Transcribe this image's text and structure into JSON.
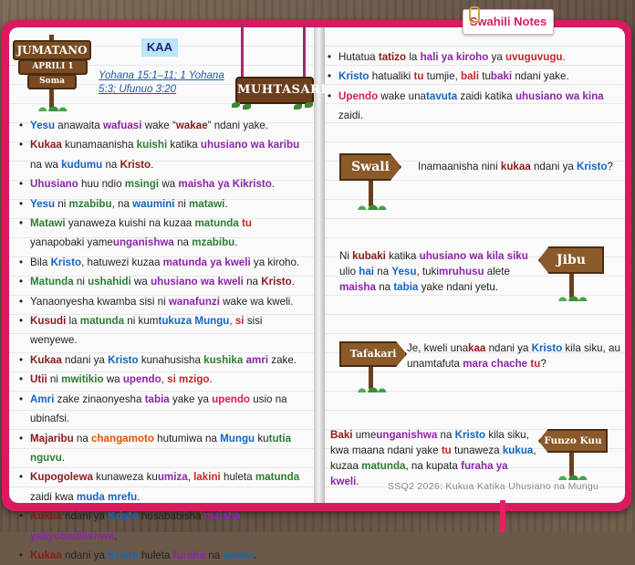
{
  "tag": {
    "label": "Swahili Notes"
  },
  "header": {
    "day": "JUMATANO",
    "date": "APRILI 1",
    "soma": "Soma",
    "badge": "KAA",
    "references": "Yohana 15:1–11; 1 Yohana 5:3; Ufunuo 3:20",
    "banner": "MUHTASARI"
  },
  "left_bullets": [
    [
      [
        "Yesu",
        "blue"
      ],
      [
        " anawaita "
      ],
      [
        "wafuasi",
        "purple"
      ],
      [
        " wake “"
      ],
      [
        "wakae",
        "maroon"
      ],
      [
        "” ndani yake."
      ]
    ],
    [
      [
        "Kukaa",
        "maroon"
      ],
      [
        " kunamaanisha "
      ],
      [
        "kuishi",
        "green"
      ],
      [
        " katika "
      ],
      [
        "uhusiano wa karibu",
        "purple"
      ],
      [
        " na wa "
      ],
      [
        "kudumu",
        "blue"
      ],
      [
        " na "
      ],
      [
        "Kristo",
        "maroon"
      ],
      [
        "."
      ]
    ],
    [
      [
        "Uhusiano",
        "purple"
      ],
      [
        " huu ndio "
      ],
      [
        "msingi",
        "green"
      ],
      [
        " wa "
      ],
      [
        "maisha ya Kikristo",
        "purple"
      ],
      [
        "."
      ]
    ],
    [
      [
        "Yesu",
        "blue"
      ],
      [
        " ni "
      ],
      [
        "mzabibu",
        "green"
      ],
      [
        ", na "
      ],
      [
        "waumini",
        "blue"
      ],
      [
        " ni "
      ],
      [
        "matawi",
        "green"
      ],
      [
        "."
      ]
    ],
    [
      [
        "Matawi",
        "green"
      ],
      [
        " yanaweza kuishi na kuzaa "
      ],
      [
        "matunda",
        "green"
      ],
      [
        " "
      ],
      [
        "tu",
        "red"
      ],
      [
        " yanapobaki yame"
      ],
      [
        "unganishwa",
        "purple"
      ],
      [
        " na "
      ],
      [
        "mzabibu",
        "green"
      ],
      [
        "."
      ]
    ],
    [
      [
        "Bila "
      ],
      [
        "Kristo",
        "blue"
      ],
      [
        ", hatuwezi kuzaa "
      ],
      [
        "matunda ya kweli",
        "purple"
      ],
      [
        " ya kiroho."
      ]
    ],
    [
      [
        "Matunda",
        "green"
      ],
      [
        " ni "
      ],
      [
        "ushahidi",
        "green"
      ],
      [
        " wa "
      ],
      [
        "uhusiano wa kweli",
        "purple"
      ],
      [
        " na "
      ],
      [
        "Kristo",
        "maroon"
      ],
      [
        "."
      ]
    ],
    [
      [
        "Yanaonyesha kwamba sisi ni "
      ],
      [
        "wanafunzi",
        "purple"
      ],
      [
        " wake wa kweli."
      ]
    ],
    [
      [
        "Kusudi",
        "maroon"
      ],
      [
        " la "
      ],
      [
        "matunda",
        "green"
      ],
      [
        " ni kum"
      ],
      [
        "tukuza",
        "blue"
      ],
      [
        " "
      ],
      [
        "Mungu",
        "blue"
      ],
      [
        ", "
      ],
      [
        "si",
        "red"
      ],
      [
        " sisi wenyewe."
      ]
    ],
    [
      [
        "Kukaa",
        "maroon"
      ],
      [
        " ndani ya "
      ],
      [
        "Kristo",
        "blue"
      ],
      [
        " kunahusisha "
      ],
      [
        "kushika",
        "green"
      ],
      [
        " "
      ],
      [
        "amri",
        "purple"
      ],
      [
        " zake."
      ]
    ],
    [
      [
        "Utii",
        "maroon"
      ],
      [
        " ni "
      ],
      [
        "mwitikio",
        "green"
      ],
      [
        " wa "
      ],
      [
        "upendo",
        "purple"
      ],
      [
        ", "
      ],
      [
        "si mzigo",
        "red"
      ],
      [
        "."
      ]
    ],
    [
      [
        "Amri",
        "blue"
      ],
      [
        " zake zinaonyesha "
      ],
      [
        "tabia",
        "purple"
      ],
      [
        " yake ya "
      ],
      [
        "upendo",
        "magenta"
      ],
      [
        " usio na ubinafsi."
      ]
    ],
    [
      [
        "Majaribu",
        "maroon"
      ],
      [
        " na "
      ],
      [
        "changamoto",
        "orange"
      ],
      [
        " hutumiwa na "
      ],
      [
        "Mungu",
        "blue"
      ],
      [
        " ku"
      ],
      [
        "tutia nguvu",
        "green"
      ],
      [
        "."
      ]
    ],
    [
      [
        "Kupogolewa",
        "maroon"
      ],
      [
        " kunaweza ku"
      ],
      [
        "umiza",
        "purple"
      ],
      [
        ", "
      ],
      [
        "lakini",
        "red"
      ],
      [
        " huleta "
      ],
      [
        "matunda",
        "green"
      ],
      [
        " zaidi kwa "
      ],
      [
        "muda mrefu",
        "blue"
      ],
      [
        "."
      ]
    ],
    [
      [
        "Kukaa",
        "maroon"
      ],
      [
        " ndani ya "
      ],
      [
        "Kristo",
        "blue"
      ],
      [
        " husababisha "
      ],
      [
        "maisha yaliyobadilishwa",
        "purple"
      ],
      [
        "."
      ]
    ],
    [
      [
        "Kukaa",
        "maroon"
      ],
      [
        " ndani ya "
      ],
      [
        "Kristo",
        "blue"
      ],
      [
        " huleta "
      ],
      [
        "furaha",
        "purple"
      ],
      [
        " na "
      ],
      [
        "amani",
        "blue"
      ],
      [
        "."
      ]
    ]
  ],
  "right_bullets": [
    [
      [
        "Hutatua "
      ],
      [
        "tatizo",
        "maroon"
      ],
      [
        " la "
      ],
      [
        "hali ya kiroho",
        "purple"
      ],
      [
        " ya "
      ],
      [
        "uvuguvugu",
        "red"
      ],
      [
        "."
      ]
    ],
    [
      [
        "Kristo",
        "blue"
      ],
      [
        " hatualiki "
      ],
      [
        "tu",
        "red"
      ],
      [
        " tumjie, "
      ],
      [
        "bali",
        "red"
      ],
      [
        " tu"
      ],
      [
        "baki",
        "purple"
      ],
      [
        " ndani yake."
      ]
    ],
    [
      [
        "Upendo",
        "magenta"
      ],
      [
        " wake una"
      ],
      [
        "tavuta",
        "blue"
      ],
      [
        " zaidi katika "
      ],
      [
        "uhusiano wa kina",
        "purple"
      ],
      [
        " zaidi."
      ]
    ]
  ],
  "signs": {
    "swali": "Swali",
    "jibu": "Jibu",
    "tafakari": "Tafakari",
    "funzo": "Funzo Kuu"
  },
  "swali_text": [
    [
      "Inamaanisha nini "
    ],
    [
      "kukaa",
      "maroon"
    ],
    [
      " ndani ya "
    ],
    [
      "Kristo",
      "blue"
    ],
    [
      "?"
    ]
  ],
  "jibu_text": [
    [
      "Ni "
    ],
    [
      "kubaki",
      "maroon"
    ],
    [
      " katika "
    ],
    [
      "uhusiano wa kila siku",
      "purple"
    ],
    [
      " ulio "
    ],
    [
      "hai",
      "blue"
    ],
    [
      " na "
    ],
    [
      "Yesu",
      "blue"
    ],
    [
      ", tuki"
    ],
    [
      "mruhusu",
      "purple"
    ],
    [
      " alete "
    ],
    [
      "maisha",
      "purple"
    ],
    [
      " na "
    ],
    [
      "tabia",
      "blue"
    ],
    [
      " yake ndani yetu."
    ]
  ],
  "tafakari_text": [
    [
      "Je, kweli una"
    ],
    [
      "kaa",
      "maroon"
    ],
    [
      " ndani ya "
    ],
    [
      "Kristo",
      "blue"
    ],
    [
      " kila siku, au unamtafuta "
    ],
    [
      "mara chache",
      "purple"
    ],
    [
      " "
    ],
    [
      "tu",
      "red"
    ],
    [
      "?"
    ]
  ],
  "funzo_text": [
    [
      "Baki",
      "maroon"
    ],
    [
      " ume"
    ],
    [
      "unganishwa",
      "purple"
    ],
    [
      " na "
    ],
    [
      "Kristo",
      "blue"
    ],
    [
      " kila siku, kwa maana ndani yake "
    ],
    [
      "tu",
      "red"
    ],
    [
      " tunaweza "
    ],
    [
      "kukua",
      "blue"
    ],
    [
      ", kuzaa "
    ],
    [
      "matunda",
      "green"
    ],
    [
      ", na kupata "
    ],
    [
      "furaha ya kweli",
      "purple"
    ],
    [
      "."
    ]
  ],
  "footer": "SSQ2 2026: Kukua Katika Uhusiano na Mungu"
}
